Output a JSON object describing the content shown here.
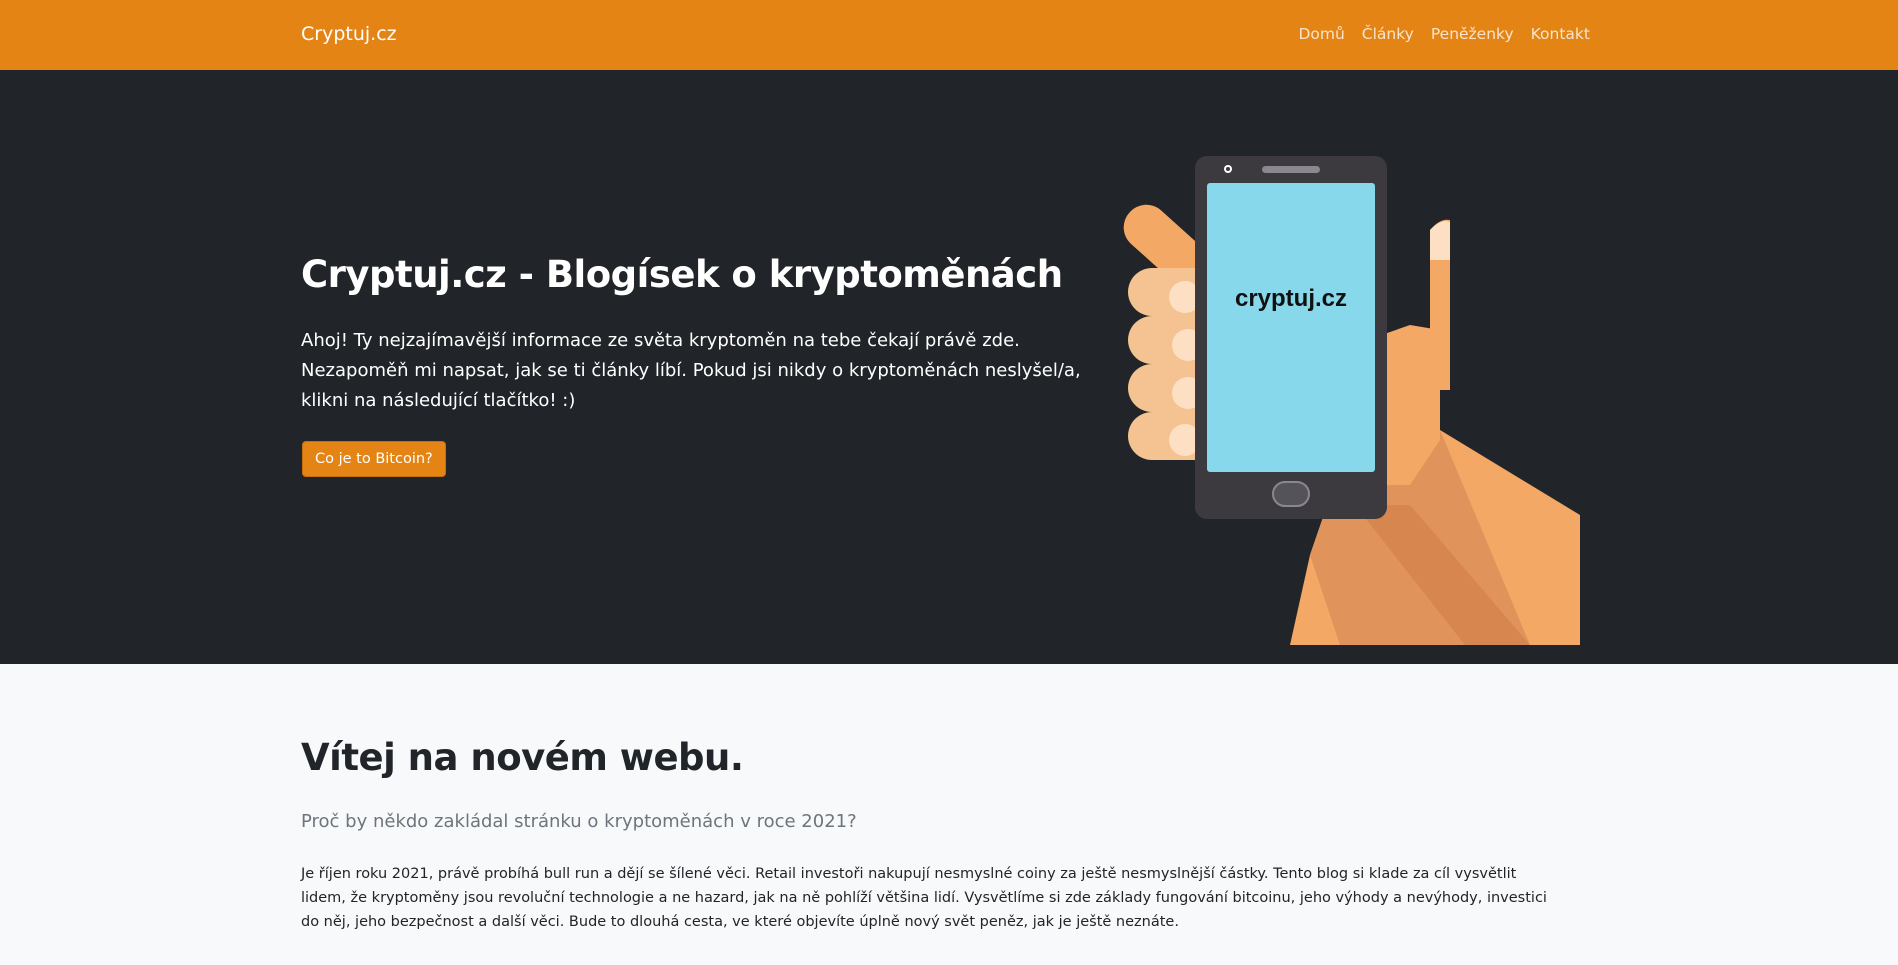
{
  "navbar": {
    "brand": "Cryptuj.cz",
    "links": [
      "Domů",
      "Články",
      "Peněženky",
      "Kontakt"
    ],
    "color": "#e48415"
  },
  "hero": {
    "title": "Cryptuj.cz - Blogísek o kryptoměnách",
    "lead": "Ahoj! Ty nejzajímavější informace ze světa kryptoměn na tebe čekají právě zde. Nezapoměň mi napsat, jak se ti články líbí. Pokud jsi nikdy o kryptoměnách neslyšel/a, klikni na následující tlačítko! :)",
    "button": "Co je to Bitcoin?",
    "phone_screen_text": "cryptuj.cz",
    "background": "#212529"
  },
  "content": {
    "heading": "Vítej na novém webu.",
    "subheading": "Proč by někdo zakládal stránku o kryptoměnách v roce 2021?",
    "paragraph": "Je říjen roku 2021, právě probíhá bull run a dějí se šílené věci. Retail investoři nakupují nesmyslné coiny za ještě nesmyslnější částky. Tento blog si klade za cíl vysvětlit lidem, že kryptoměny jsou revoluční technologie a ne hazard, jak na ně pohlíží většina lidí. Vysvětlíme si zde základy fungování bitcoinu, jeho výhody a nevýhody, investici do něj, jeho bezpečnost a další věci. Bude to dlouhá cesta, ve které objevíte úplně nový svět peněz, jak je ještě neznáte."
  }
}
